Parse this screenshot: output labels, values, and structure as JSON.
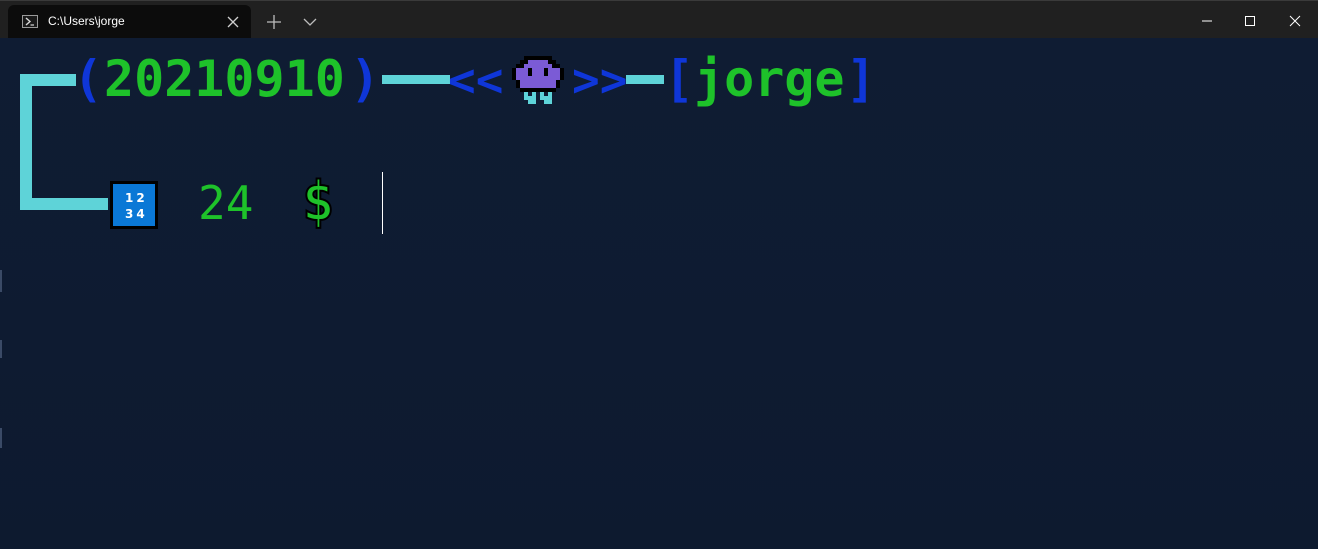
{
  "window": {
    "tab_title": "C:\\Users\\jorge",
    "icons": {
      "tab": "powershell-icon",
      "close_tab": "close-icon",
      "new_tab": "plus-icon",
      "dropdown": "chevron-down-icon",
      "minimize": "minimize-icon",
      "maximize": "maximize-icon",
      "close": "close-icon"
    }
  },
  "prompt": {
    "open_paren": "(",
    "date": "20210910",
    "close_paren": ")",
    "left_chevrons": "<<",
    "emoji": "alien-monster-icon",
    "right_chevrons": ">>",
    "open_bracket": "[",
    "user": "jorge",
    "close_bracket": "]",
    "input_numbers_icon": "input-numbers-icon",
    "input_numbers_digits_top": "12",
    "input_numbers_digits_bottom": "34",
    "count": "24",
    "symbol": "$"
  },
  "colors": {
    "background": "#0f1b32",
    "green": "#1ec22a",
    "blue": "#0f36d8",
    "cyan_bar": "#5ed3d8",
    "icon_blue": "#0a78d6",
    "alien_purple": "#7b5bd6"
  }
}
